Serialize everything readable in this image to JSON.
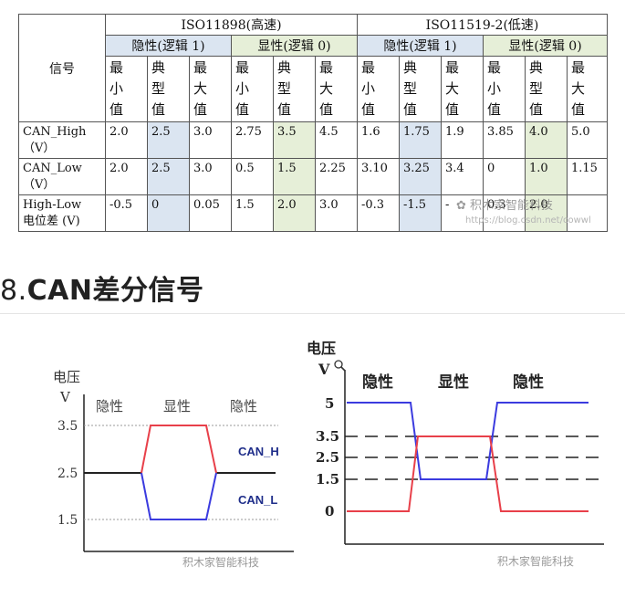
{
  "table": {
    "signal_header": "信号",
    "standards": [
      {
        "name": "ISO11898(高速)",
        "modes": [
          "隐性(逻辑 1)",
          "显性(逻辑 0)"
        ]
      },
      {
        "name": "ISO11519-2(低速)",
        "modes": [
          "隐性(逻辑 1)",
          "显性(逻辑 0)"
        ]
      }
    ],
    "sub_headers": [
      "最\n小\n值",
      "典\n型\n值",
      "最\n大\n值",
      "最\n小\n值",
      "典\n型\n值",
      "最\n大\n值",
      "最\n小\n值",
      "典\n型\n值",
      "最\n大\n值",
      "最\n小\n值",
      "典\n型\n值",
      "最\n大\n值"
    ],
    "rows": [
      {
        "label": "CAN_High\n（V）",
        "values": [
          "2.0",
          "2.5",
          "3.0",
          "2.75",
          "3.5",
          "4.5",
          "1.6",
          "1.75",
          "1.9",
          "3.85",
          "4.0",
          "5.0"
        ]
      },
      {
        "label": "CAN_Low\n（V）",
        "values": [
          "2.0",
          "2.5",
          "3.0",
          "0.5",
          "1.5",
          "2.25",
          "3.10",
          "3.25",
          "3.4",
          "0",
          "1.0",
          "1.15"
        ]
      },
      {
        "label": "High-Low\n电位差 (V)",
        "values": [
          "-0.5",
          "0",
          "0.05",
          "1.5",
          "2.0",
          "3.0",
          "-0.3",
          "-1.5",
          "-",
          "0.3",
          "2.0",
          ""
        ]
      }
    ]
  },
  "watermark": {
    "brand": "积木家智能科技",
    "url": "https://blog.csdn.net/cowwl"
  },
  "section": {
    "number": "8.",
    "title": "CAN差分信号"
  },
  "left_diagram": {
    "y_unit_line1": "电压",
    "y_unit_line2": "V",
    "states": [
      "隐性",
      "显性",
      "隐性"
    ],
    "ticks": [
      "3.5",
      "2.5",
      "1.5"
    ],
    "can_h_label": "CAN_H",
    "can_l_label": "CAN_L",
    "watermark": "积木家智能科技",
    "colors": {
      "can_h": "#e8404a",
      "can_l": "#3b3bdf",
      "baseline": "#222222"
    }
  },
  "right_diagram": {
    "y_unit_line1": "电压",
    "y_unit_line2": "V",
    "states": [
      "隐性",
      "显性",
      "隐性"
    ],
    "ticks": [
      "5",
      "3.5",
      "2.5",
      "1.5",
      "0"
    ],
    "watermark": "积木家智能科技",
    "colors": {
      "blue_line": "#3b3bdf",
      "red_line": "#e8404a"
    }
  }
}
